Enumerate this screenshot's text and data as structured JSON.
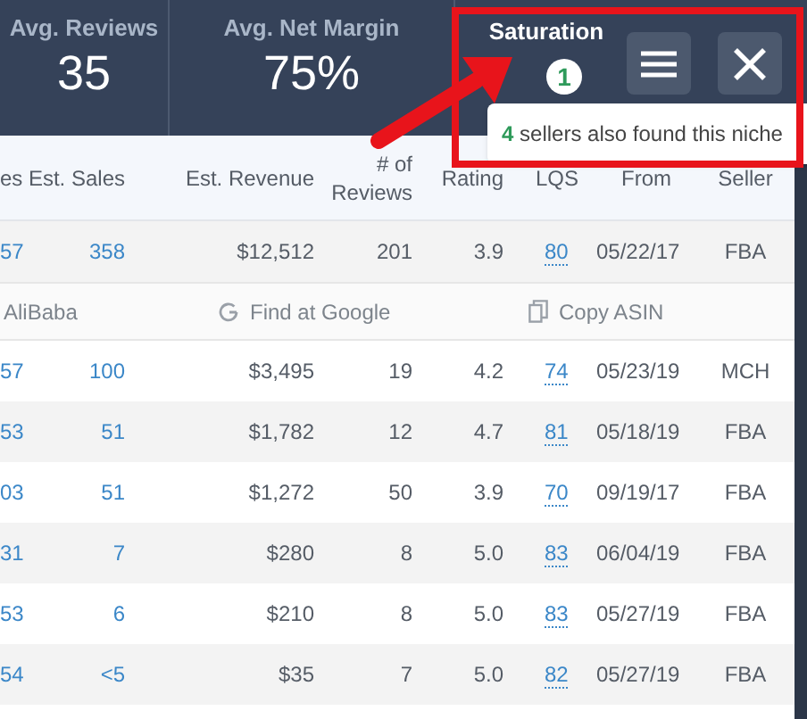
{
  "stats": [
    {
      "label": "Avg. Reviews",
      "value": "35"
    },
    {
      "label": "Avg. Net Margin",
      "value": "75%"
    }
  ],
  "saturation": {
    "label": "Saturation",
    "badge": "1"
  },
  "toolbar": [
    {
      "kind": "menu"
    },
    {
      "kind": "close"
    }
  ],
  "tooltip": {
    "count": "4",
    "text": "sellers also found this niche"
  },
  "table": {
    "columns": [
      {
        "label": "es",
        "kind": "link"
      },
      {
        "label": "Est. Sales",
        "kind": "link"
      },
      {
        "label": "Est. Revenue",
        "kind": "text"
      },
      {
        "label": "# of Reviews",
        "kind": "text"
      },
      {
        "label": "Rating",
        "kind": "text"
      },
      {
        "label": "LQS",
        "kind": "score"
      },
      {
        "label": "From",
        "kind": "date"
      },
      {
        "label": "Seller",
        "kind": "center"
      }
    ],
    "rows": [
      {
        "cells": [
          "57",
          "358",
          "$12,512",
          "201",
          "3.9",
          "80",
          "05/22/17",
          "FBA"
        ],
        "actions": [
          {
            "kind": "none",
            "label": "AliBaba"
          },
          {
            "kind": "google",
            "label": "Find at Google"
          },
          {
            "kind": "copy",
            "label": "Copy ASIN"
          }
        ]
      },
      {
        "cells": [
          "57",
          "100",
          "$3,495",
          "19",
          "4.2",
          "74",
          "05/23/19",
          "MCH"
        ]
      },
      {
        "cells": [
          "53",
          "51",
          "$1,782",
          "12",
          "4.7",
          "81",
          "05/18/19",
          "FBA"
        ]
      },
      {
        "cells": [
          "03",
          "51",
          "$1,272",
          "50",
          "3.9",
          "70",
          "09/19/17",
          "FBA"
        ]
      },
      {
        "cells": [
          "31",
          "7",
          "$280",
          "8",
          "5.0",
          "83",
          "06/04/19",
          "FBA"
        ]
      },
      {
        "cells": [
          "53",
          "6",
          "$210",
          "8",
          "5.0",
          "83",
          "05/27/19",
          "FBA"
        ]
      },
      {
        "cells": [
          "54",
          "<5",
          "$35",
          "7",
          "5.0",
          "82",
          "05/27/19",
          "FBA"
        ]
      }
    ]
  }
}
